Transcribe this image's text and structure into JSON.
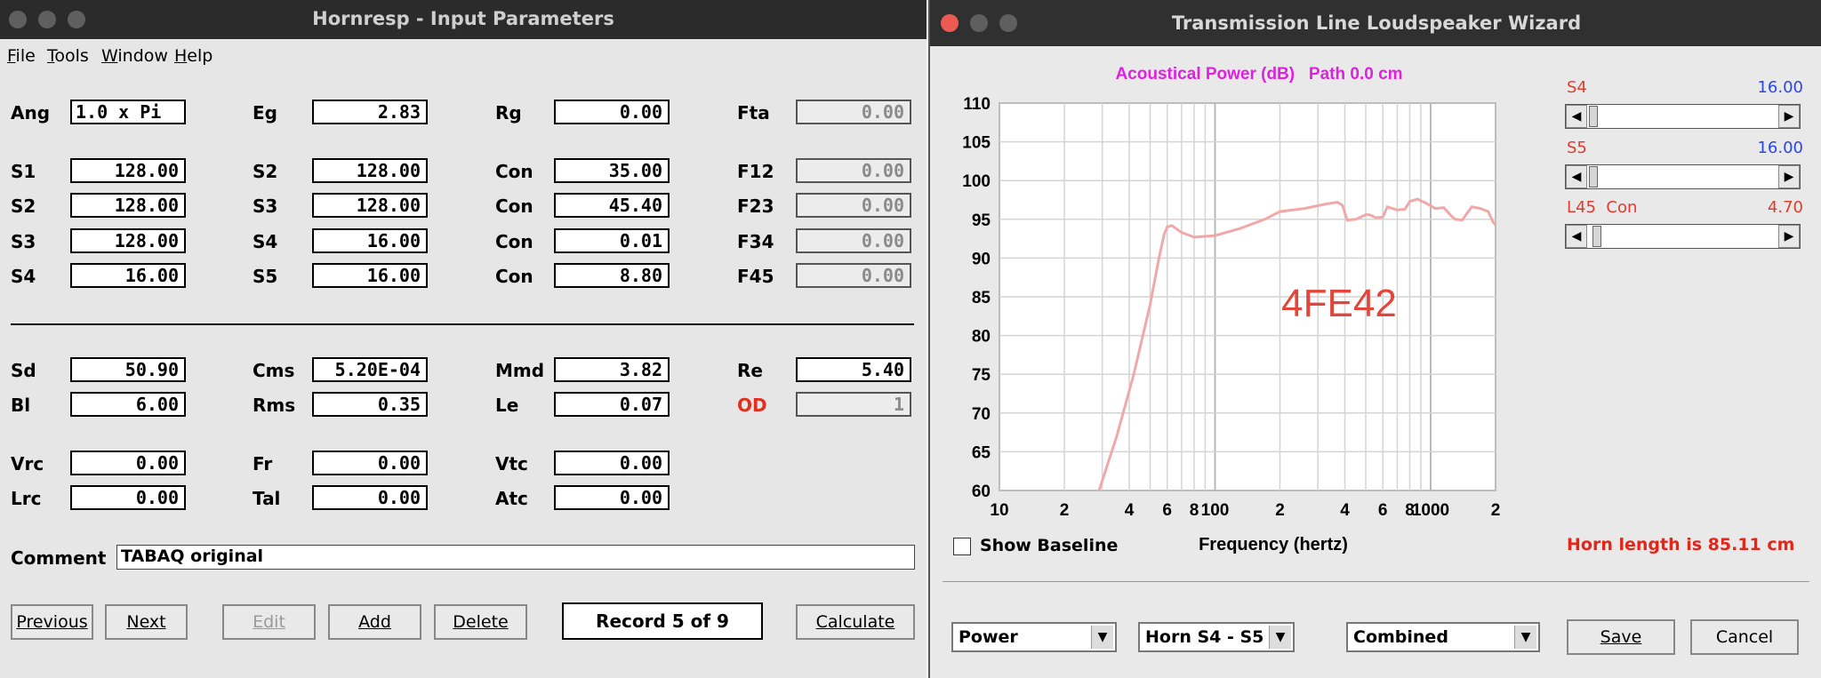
{
  "left_window": {
    "title": "Hornresp - Input Parameters",
    "menu": [
      {
        "pre": "",
        "key": "F",
        "post": "ile"
      },
      {
        "pre": "",
        "key": "T",
        "post": "ools"
      },
      {
        "pre": "",
        "key": "W",
        "post": "indow"
      },
      {
        "pre": "",
        "key": "H",
        "post": "elp"
      }
    ],
    "params": {
      "ang": {
        "label": "Ang",
        "value": "1.0 x Pi"
      },
      "eg": {
        "label": "Eg",
        "value": "2.83"
      },
      "rg": {
        "label": "Rg",
        "value": "0.00"
      },
      "fta": {
        "label": "Fta",
        "value": "0.00"
      },
      "s1": {
        "label": "S1",
        "value": "128.00"
      },
      "s2a": {
        "label": "S2",
        "value": "128.00"
      },
      "con1": {
        "label": "Con",
        "value": "35.00"
      },
      "f12": {
        "label": "F12",
        "value": "0.00"
      },
      "s2b": {
        "label": "S2",
        "value": "128.00"
      },
      "s3a": {
        "label": "S3",
        "value": "128.00"
      },
      "con2": {
        "label": "Con",
        "value": "45.40"
      },
      "f23": {
        "label": "F23",
        "value": "0.00"
      },
      "s3b": {
        "label": "S3",
        "value": "128.00"
      },
      "s4a": {
        "label": "S4",
        "value": "16.00"
      },
      "con3": {
        "label": "Con",
        "value": "0.01"
      },
      "f34": {
        "label": "F34",
        "value": "0.00"
      },
      "s4b": {
        "label": "S4",
        "value": "16.00"
      },
      "s5a": {
        "label": "S5",
        "value": "16.00"
      },
      "con4": {
        "label": "Con",
        "value": "8.80"
      },
      "f45": {
        "label": "F45",
        "value": "0.00"
      },
      "sd": {
        "label": "Sd",
        "value": "50.90"
      },
      "cms": {
        "label": "Cms",
        "value": "5.20E-04"
      },
      "mmd": {
        "label": "Mmd",
        "value": "3.82"
      },
      "re": {
        "label": "Re",
        "value": "5.40"
      },
      "bl": {
        "label": "Bl",
        "value": "6.00"
      },
      "rms": {
        "label": "Rms",
        "value": "0.35"
      },
      "le": {
        "label": "Le",
        "value": "0.07"
      },
      "od": {
        "label": "OD",
        "value": "1"
      },
      "vrc": {
        "label": "Vrc",
        "value": "0.00"
      },
      "fr": {
        "label": "Fr",
        "value": "0.00"
      },
      "vtc": {
        "label": "Vtc",
        "value": "0.00"
      },
      "lrc": {
        "label": "Lrc",
        "value": "0.00"
      },
      "tal": {
        "label": "Tal",
        "value": "0.00"
      },
      "atc": {
        "label": "Atc",
        "value": "0.00"
      }
    },
    "comment_label": "Comment",
    "comment_value": "TABAQ original",
    "buttons": {
      "previous": "Previous",
      "next": "Next",
      "edit": "Edit",
      "add": "Add",
      "delete": "Delete",
      "calculate": "Calculate"
    },
    "record_text": "Record 5 of 9"
  },
  "right_window": {
    "title": "Transmission Line Loudspeaker Wizard",
    "sliders": [
      {
        "label": "S4",
        "value": "16.00",
        "position": 0.03
      },
      {
        "label": "S5",
        "value": "16.00",
        "position": 0.03
      },
      {
        "label": "L45  Con",
        "value": "4.70",
        "position": 0.05
      }
    ],
    "show_baseline_label": "Show Baseline",
    "show_baseline_checked": false,
    "horn_length": "Horn length is 85.11 cm",
    "dropdowns": {
      "plot": "Power",
      "section": "Horn S4 - S5",
      "mode": "Combined"
    },
    "buttons": {
      "save": "Save",
      "cancel": "Cancel"
    }
  },
  "colors": {
    "curve": "#f0a8a8",
    "chart_title": "#e020e0",
    "annotation": "#e2463a",
    "horn_length": "#e2261a",
    "od_label": "#e23020",
    "slider_label": "#e23b2e",
    "slider_value": "#2a47e6"
  },
  "chart_data": {
    "type": "line",
    "title": "Acoustical Power (dB)   Path 0.0 cm",
    "xlabel": "Frequency (hertz)",
    "ylabel": "",
    "x_scale": "log",
    "xlim": [
      10,
      2000
    ],
    "ylim": [
      60,
      110
    ],
    "yticks": [
      "60",
      "65",
      "70",
      "75",
      "80",
      "85",
      "90",
      "95",
      "100",
      "105",
      "110"
    ],
    "xtick_labels": [
      {
        "v": 10,
        "t": "10"
      },
      {
        "v": 20,
        "t": "2"
      },
      {
        "v": 40,
        "t": "4"
      },
      {
        "v": 60,
        "t": "6"
      },
      {
        "v": 80,
        "t": "8"
      },
      {
        "v": 100,
        "t": "100"
      },
      {
        "v": 200,
        "t": "2"
      },
      {
        "v": 400,
        "t": "4"
      },
      {
        "v": 600,
        "t": "6"
      },
      {
        "v": 800,
        "t": "8"
      },
      {
        "v": 1000,
        "t": "1000"
      },
      {
        "v": 2000,
        "t": "2"
      }
    ],
    "annotation": "4FE42",
    "grid": true,
    "series": [
      {
        "x": [
          29,
          35,
          42,
          50,
          55,
          58,
          60,
          63,
          70,
          80,
          100,
          130,
          170,
          200,
          260,
          330,
          370,
          390,
          410,
          450,
          500,
          520,
          560,
          600,
          630,
          700,
          760,
          800,
          870,
          900,
          950,
          1050,
          1150,
          1250,
          1300,
          1400,
          1550,
          1700,
          1850,
          1950,
          2000
        ],
        "y": [
          60,
          67,
          75,
          84,
          90,
          93,
          94,
          94.2,
          93.3,
          92.7,
          92.9,
          93.8,
          95,
          96,
          96.4,
          97,
          97.2,
          96.8,
          94.9,
          95,
          95.6,
          95.6,
          95.2,
          95.3,
          96.6,
          96.2,
          96.3,
          97.3,
          97.6,
          97.4,
          97.1,
          96.4,
          96.5,
          95.4,
          95,
          94.9,
          96.6,
          96.4,
          96,
          94.6,
          94.3
        ]
      }
    ]
  }
}
